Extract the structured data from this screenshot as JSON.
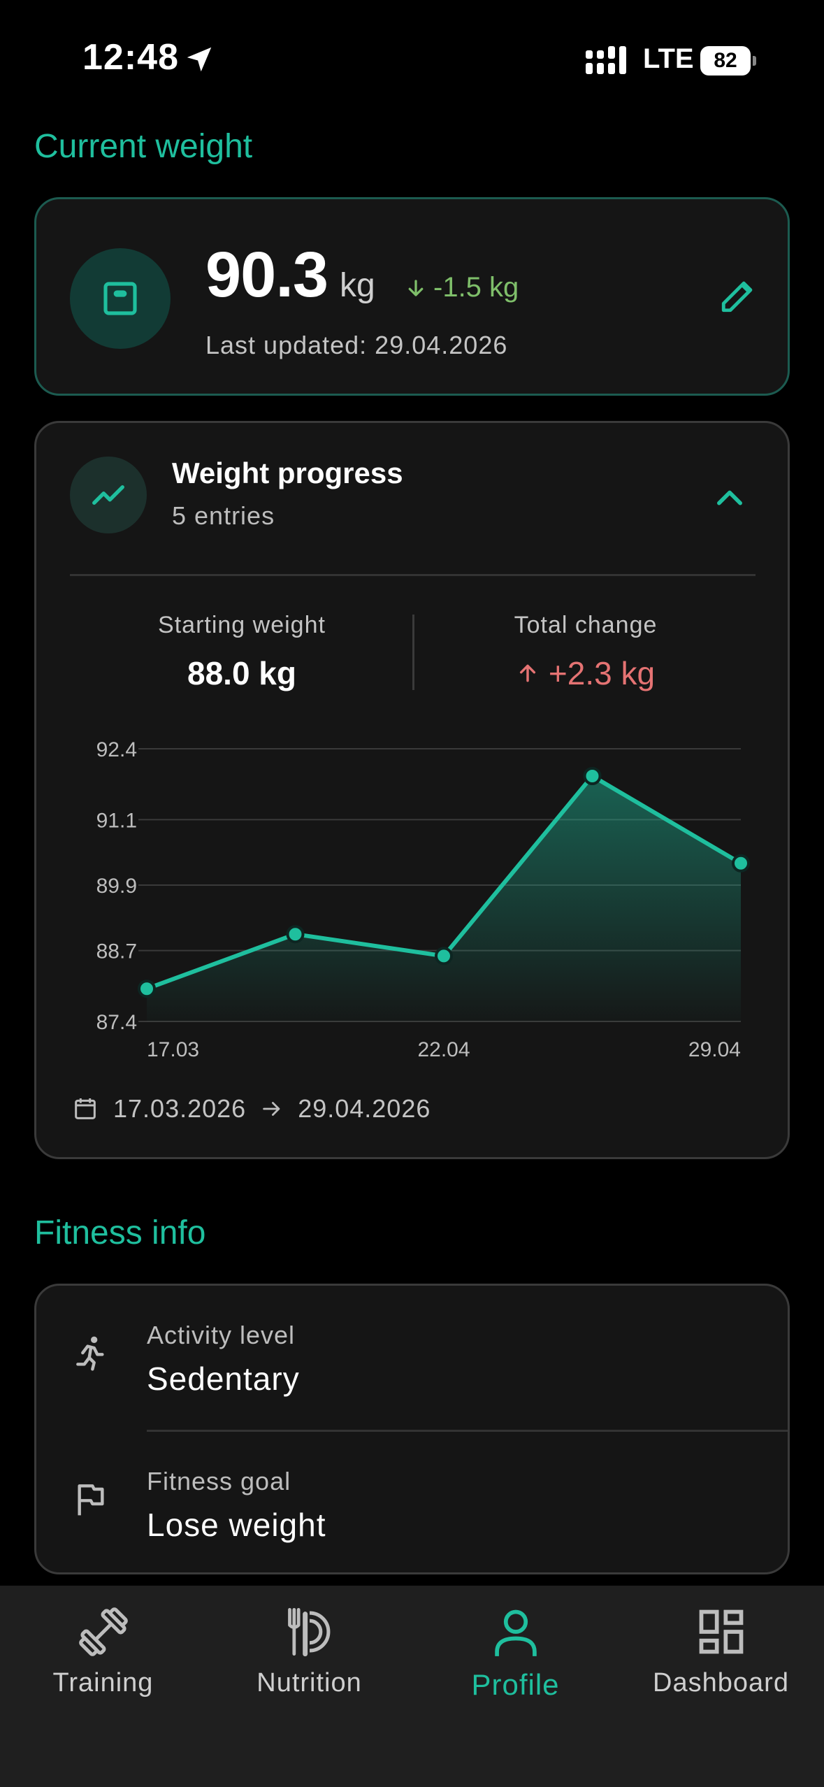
{
  "status_bar": {
    "time": "12:48",
    "network": "LTE",
    "battery": "82"
  },
  "current_weight": {
    "section_title": "Current weight",
    "value": "90.3",
    "unit": "kg",
    "delta": "-1.5 kg",
    "last_updated": "Last updated: 29.04.2026"
  },
  "weight_progress": {
    "title": "Weight progress",
    "subtitle": "5 entries",
    "starting_label": "Starting weight",
    "starting_value": "88.0 kg",
    "change_label": "Total change",
    "change_value": "+2.3 kg",
    "date_start": "17.03.2026",
    "date_end": "29.04.2026"
  },
  "chart_data": {
    "type": "area",
    "x": [
      "17.03",
      "",
      "22.04",
      "",
      "29.04"
    ],
    "values": [
      88.0,
      89.0,
      88.6,
      91.9,
      90.3
    ],
    "yticks": [
      92.4,
      91.1,
      89.9,
      88.7,
      87.4
    ],
    "xtick_labels": [
      "17.03",
      "22.04",
      "29.04"
    ],
    "ylim": [
      87.4,
      92.4
    ],
    "grid": true,
    "color": "#1fbf9e"
  },
  "fitness_info": {
    "section_title": "Fitness info",
    "activity_label": "Activity level",
    "activity_value": "Sedentary",
    "goal_label": "Fitness goal",
    "goal_value": "Lose weight"
  },
  "nav": {
    "items": [
      {
        "label": "Training",
        "icon": "dumbbell-icon"
      },
      {
        "label": "Nutrition",
        "icon": "utensils-icon"
      },
      {
        "label": "Profile",
        "icon": "person-icon"
      },
      {
        "label": "Dashboard",
        "icon": "dashboard-icon"
      }
    ],
    "active": "Profile"
  },
  "colors": {
    "accent": "#1fbf9e",
    "positive": "#7fbf6a",
    "negative": "#e57373"
  }
}
